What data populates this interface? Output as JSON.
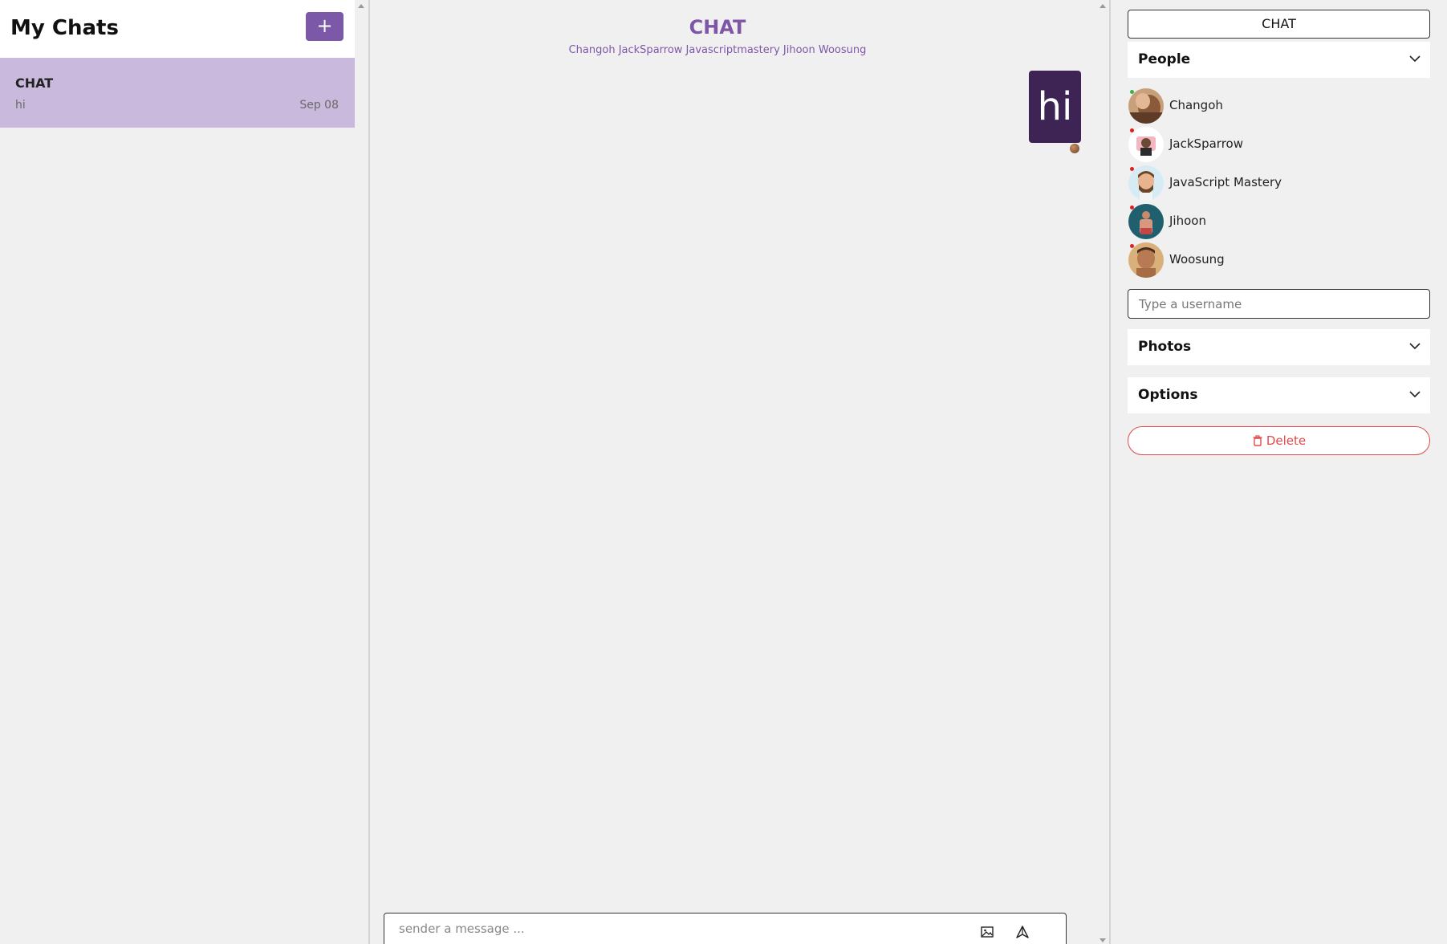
{
  "sidebar": {
    "title": "My Chats",
    "new_chat_label": "+",
    "chats": [
      {
        "title": "CHAT",
        "preview": "hi",
        "date": "Sep 08"
      }
    ]
  },
  "chat": {
    "title": "CHAT",
    "subtitle": "Changoh JackSparrow Javascriptmastery Jihoon Woosung",
    "messages": [
      {
        "text": "hi",
        "from": "me"
      }
    ],
    "composer": {
      "placeholder": "sender a message ..."
    }
  },
  "settings": {
    "title": "CHAT",
    "people_label": "People",
    "people": [
      {
        "name": "Changoh",
        "online": true,
        "avatar": "photo-changoh"
      },
      {
        "name": "JackSparrow",
        "online": false,
        "avatar": "photo-jacksparrow"
      },
      {
        "name": "JavaScript Mastery",
        "online": false,
        "avatar": "photo-javascript-mastery"
      },
      {
        "name": "Jihoon",
        "online": false,
        "avatar": "photo-jihoon"
      },
      {
        "name": "Woosung",
        "online": false,
        "avatar": "photo-woosung"
      }
    ],
    "username_placeholder": "Type a username",
    "photos_label": "Photos",
    "options_label": "Options",
    "delete_label": "Delete"
  },
  "colors": {
    "accent": "#7b58a8",
    "selected_chat": "#c9b9dd",
    "bubble": "#3d2455",
    "danger": "#e04a4a",
    "online": "#3cb043",
    "offline": "#e02020"
  },
  "icons": {
    "image": "image-icon",
    "send": "send-icon",
    "chevron": "chevron-down-icon",
    "delete": "trash-icon"
  }
}
